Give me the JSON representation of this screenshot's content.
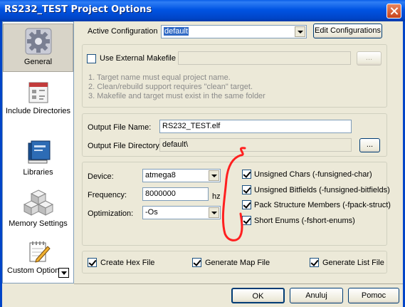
{
  "window": {
    "title": "RS232_TEST Project Options"
  },
  "sidebar": {
    "items": [
      {
        "label": "General",
        "icon": "gear-icon",
        "selected": true
      },
      {
        "label": "Include Directories",
        "icon": "include-directories-icon"
      },
      {
        "label": "Libraries",
        "icon": "books-icon"
      },
      {
        "label": "Memory Settings",
        "icon": "memory-blocks-icon"
      },
      {
        "label": "Custom Options",
        "icon": "pencil-notepad-icon"
      }
    ]
  },
  "active_configuration": {
    "label": "Active Configuration",
    "value": "default",
    "edit_button": "Edit Configurations"
  },
  "external_makefile": {
    "checkbox_label": "Use External Makefile",
    "checked": false,
    "path_value": "",
    "browse_button": "...",
    "notes": [
      "1. Target name must equal project name.",
      "2. Clean/rebuild support requires \"clean\" target.",
      "3. Makefile and target must exist in the same folder"
    ]
  },
  "output": {
    "file_name_label": "Output File Name:",
    "file_name_value": "RS232_TEST.elf",
    "directory_label": "Output File Directory:",
    "directory_value": "default\\",
    "browse_button": "..."
  },
  "device_settings": {
    "device_label": "Device:",
    "device_value": "atmega8",
    "frequency_label": "Frequency:",
    "frequency_value": "8000000",
    "frequency_unit": "hz",
    "optimization_label": "Optimization:",
    "optimization_value": "-Os"
  },
  "compiler_flags": [
    {
      "label": "Unsigned Chars (-funsigned-char)",
      "checked": true
    },
    {
      "label": "Unsigned Bitfields (-funsigned-bitfields)",
      "checked": true
    },
    {
      "label": "Pack Structure Members (-fpack-struct)",
      "checked": true
    },
    {
      "label": "Short Enums (-fshort-enums)",
      "checked": true
    }
  ],
  "output_files": [
    {
      "label": "Create Hex File",
      "checked": true
    },
    {
      "label": "Generate Map File",
      "checked": true
    },
    {
      "label": "Generate List File",
      "checked": true
    }
  ],
  "buttons": {
    "ok": "OK",
    "cancel": "Anuluj",
    "help": "Pomoc"
  },
  "colors": {
    "titlebar": "#0054e3",
    "selection": "#316ac5",
    "annotation": "#ff2020",
    "check": "#21a121"
  }
}
